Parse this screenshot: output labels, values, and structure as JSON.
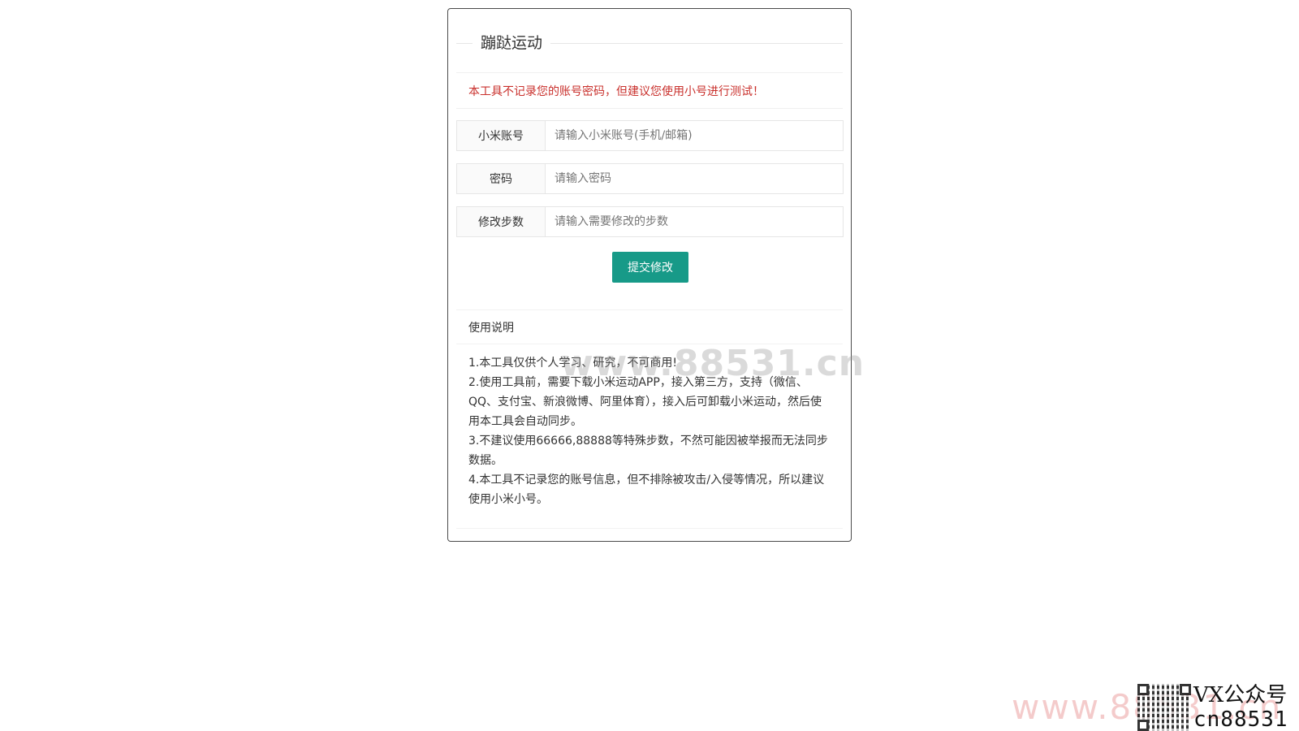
{
  "card": {
    "title": "蹦跶运动",
    "notice": "本工具不记录您的账号密码，但建议您使用小号进行测试！"
  },
  "form": {
    "fields": [
      {
        "label": "小米账号",
        "placeholder": "请输入小米账号(手机/邮箱)",
        "value": ""
      },
      {
        "label": "密码",
        "placeholder": "请输入密码",
        "value": ""
      },
      {
        "label": "修改步数",
        "placeholder": "请输入需要修改的步数",
        "value": ""
      }
    ],
    "submit_label": "提交修改"
  },
  "instructions": {
    "title": "使用说明",
    "items": [
      "1.本工具仅供个人学习、研究，不可商用!",
      "2.使用工具前，需要下载小米运动APP，接入第三方，支持（微信、QQ、支付宝、新浪微博、阿里体育），接入后可卸载小米运动，然后使用本工具会自动同步。",
      "3.不建议使用66666,88888等特殊步数，不然可能因被举报而无法同步数据。",
      "4.本工具不记录您的账号信息，但不排除被攻击/入侵等情况，所以建议使用小米小号。"
    ]
  },
  "watermarks": {
    "center": "www.88531.cn",
    "bottom": "www.88531.cn",
    "vx_label": "VX公众号",
    "vx_id": "cn88531"
  },
  "colors": {
    "accent": "#179a88",
    "notice": "#c9302c"
  }
}
